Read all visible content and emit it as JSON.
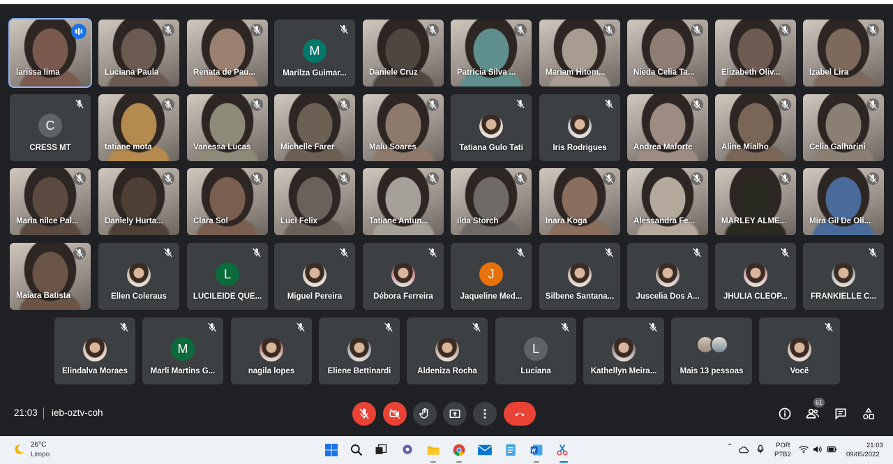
{
  "colors": {
    "background": "#202124",
    "tile": "#3c4043",
    "active_outline": "#8ab4f8",
    "red_control": "#ea4335",
    "taskbar": "#eef1f6"
  },
  "participants": [
    {
      "name": "larissa lima",
      "kind": "video",
      "active": true,
      "speaking": true,
      "tone": "#7a5a4e"
    },
    {
      "name": "Luciana Paula",
      "kind": "video",
      "tone": "#6b5a52"
    },
    {
      "name": "Renata de Pau...",
      "kind": "video",
      "tone": "#9a8070"
    },
    {
      "name": "Marilza Guimar...",
      "kind": "letter",
      "letter": "M",
      "avatar_color": "#00796b"
    },
    {
      "name": "Daniele Cruz",
      "kind": "video",
      "tone": "#4f4640"
    },
    {
      "name": "Patrícia Silva ...",
      "kind": "video",
      "tone": "#5f8f8c"
    },
    {
      "name": "Mariam Hitom...",
      "kind": "video",
      "tone": "#a89c92"
    },
    {
      "name": "Nieda Celia Ta...",
      "kind": "video",
      "tone": "#8e7e74"
    },
    {
      "name": "Elizabeth Oliv...",
      "kind": "video",
      "tone": "#6e5c52"
    },
    {
      "name": "Izabel Lira",
      "kind": "video",
      "tone": "#7d6a5c"
    },
    {
      "name": "CRESS MT",
      "kind": "letter",
      "letter": "C",
      "avatar_color": "#5f6368"
    },
    {
      "name": "tatiane mota",
      "kind": "video",
      "tone": "#b48a4e"
    },
    {
      "name": "Vanessa Lucas",
      "kind": "video",
      "tone": "#8c8a78"
    },
    {
      "name": "Michelle Farer",
      "kind": "video",
      "tone": "#6c6054"
    },
    {
      "name": "Malu Soares",
      "kind": "video",
      "tone": "#8e7a6c"
    },
    {
      "name": "Tatiana Gulo Tati",
      "kind": "photo",
      "avatar_color": "#d8c2b0"
    },
    {
      "name": "Iris Rodrigues",
      "kind": "photo",
      "avatar_color": "#9fb4c6"
    },
    {
      "name": "Andrea Maforte",
      "kind": "video",
      "tone": "#9c8c82"
    },
    {
      "name": "Aline Mialho",
      "kind": "video",
      "tone": "#7a6656"
    },
    {
      "name": "Celia Galharini",
      "kind": "video",
      "tone": "#8a7f72"
    },
    {
      "name": "Maria nilce Pal...",
      "kind": "video",
      "tone": "#5a4a40"
    },
    {
      "name": "Daniely Hurta...",
      "kind": "video",
      "tone": "#4e4036"
    },
    {
      "name": "Clara Sol",
      "kind": "video",
      "tone": "#7a5e50"
    },
    {
      "name": "Luci Felix",
      "kind": "video",
      "tone": "#6a625a"
    },
    {
      "name": "Tatiane Antun...",
      "kind": "video",
      "tone": "#a6a09a"
    },
    {
      "name": "Ilda Storch",
      "kind": "video",
      "tone": "#6e6a66"
    },
    {
      "name": "Inara Koga",
      "kind": "video",
      "tone": "#8a6e5e"
    },
    {
      "name": "Alessandra Fe...",
      "kind": "video",
      "tone": "#b5a89c"
    },
    {
      "name": "MARLEY ALME...",
      "kind": "video",
      "tone": "#2a2a22"
    },
    {
      "name": "Mira Gil De Oli...",
      "kind": "video",
      "tone": "#4a6a9a"
    },
    {
      "name": "Maiara Batista",
      "kind": "video",
      "tone": "#6a5446"
    },
    {
      "name": "Ellen Coleraus",
      "kind": "photo",
      "avatar_color": "#b2a48c"
    },
    {
      "name": "LUCILEIDE QUE...",
      "kind": "letter",
      "letter": "L",
      "avatar_color": "#0b6b3a"
    },
    {
      "name": "Miguel Pereira",
      "kind": "photo",
      "avatar_color": "#c9b9a8"
    },
    {
      "name": "Débora Ferreira",
      "kind": "photo",
      "avatar_color": "#b04a5a"
    },
    {
      "name": "Jaqueline Med...",
      "kind": "letter",
      "letter": "J",
      "avatar_color": "#e8710a"
    },
    {
      "name": "Silbene Santana...",
      "kind": "photo",
      "avatar_color": "#c0a090"
    },
    {
      "name": "Juscelia Dos A...",
      "kind": "photo",
      "avatar_color": "#8c7a6c"
    },
    {
      "name": "JHULIA CLEOP...",
      "kind": "photo",
      "avatar_color": "#c27a8a"
    },
    {
      "name": "FRANKIELLE C...",
      "kind": "photo",
      "avatar_color": "#6e8c9c"
    },
    {
      "name": "Elindalva Moraes",
      "kind": "photo",
      "avatar_color": "#c9a48a"
    },
    {
      "name": "Marli Martins G...",
      "kind": "letter",
      "letter": "M",
      "avatar_color": "#0b6b3a"
    },
    {
      "name": "nagila lopes",
      "kind": "photo",
      "avatar_color": "#a04030"
    },
    {
      "name": "Eliene Bettinardi",
      "kind": "photo",
      "avatar_color": "#6a7a8a"
    },
    {
      "name": "Aldeniza Rocha",
      "kind": "photo",
      "avatar_color": "#8c6a4a"
    },
    {
      "name": "Luciana",
      "kind": "letter",
      "letter": "L",
      "avatar_color": "#5f6368"
    },
    {
      "name": "Kathellyn Meira...",
      "kind": "photo",
      "avatar_color": "#4a3a30"
    },
    {
      "name": "Mais 13 pessoas",
      "kind": "more"
    },
    {
      "name": "Você",
      "kind": "photo",
      "avatar_color": "#b89a8a"
    }
  ],
  "meeting": {
    "time": "21:03",
    "code": "ieb-oztv-coh",
    "participant_count": "61"
  },
  "controls": [
    {
      "name": "mic-off-button",
      "icon": "mic-off-icon"
    },
    {
      "name": "camera-off-button",
      "icon": "camera-off-icon"
    },
    {
      "name": "raise-hand-button",
      "icon": "hand-icon"
    },
    {
      "name": "present-button",
      "icon": "present-icon"
    },
    {
      "name": "more-options-button",
      "icon": "more-vert-icon"
    },
    {
      "name": "leave-call-button",
      "icon": "phone-hangup-icon"
    }
  ],
  "right_controls": [
    "info-icon",
    "people-icon",
    "chat-icon",
    "activities-icon"
  ],
  "taskbar": {
    "temperature": "26°C",
    "condition": "Limpo",
    "lang_line1": "POR",
    "lang_line2": "PTB2",
    "clock_time": "21:03",
    "clock_date": "09/05/2022",
    "apps": [
      "windows-start-icon",
      "search-icon",
      "task-view-icon",
      "chat-icon",
      "file-explorer-icon",
      "chrome-icon",
      "mail-icon",
      "notepad-icon",
      "word-icon",
      "snipping-tool-icon"
    ]
  }
}
